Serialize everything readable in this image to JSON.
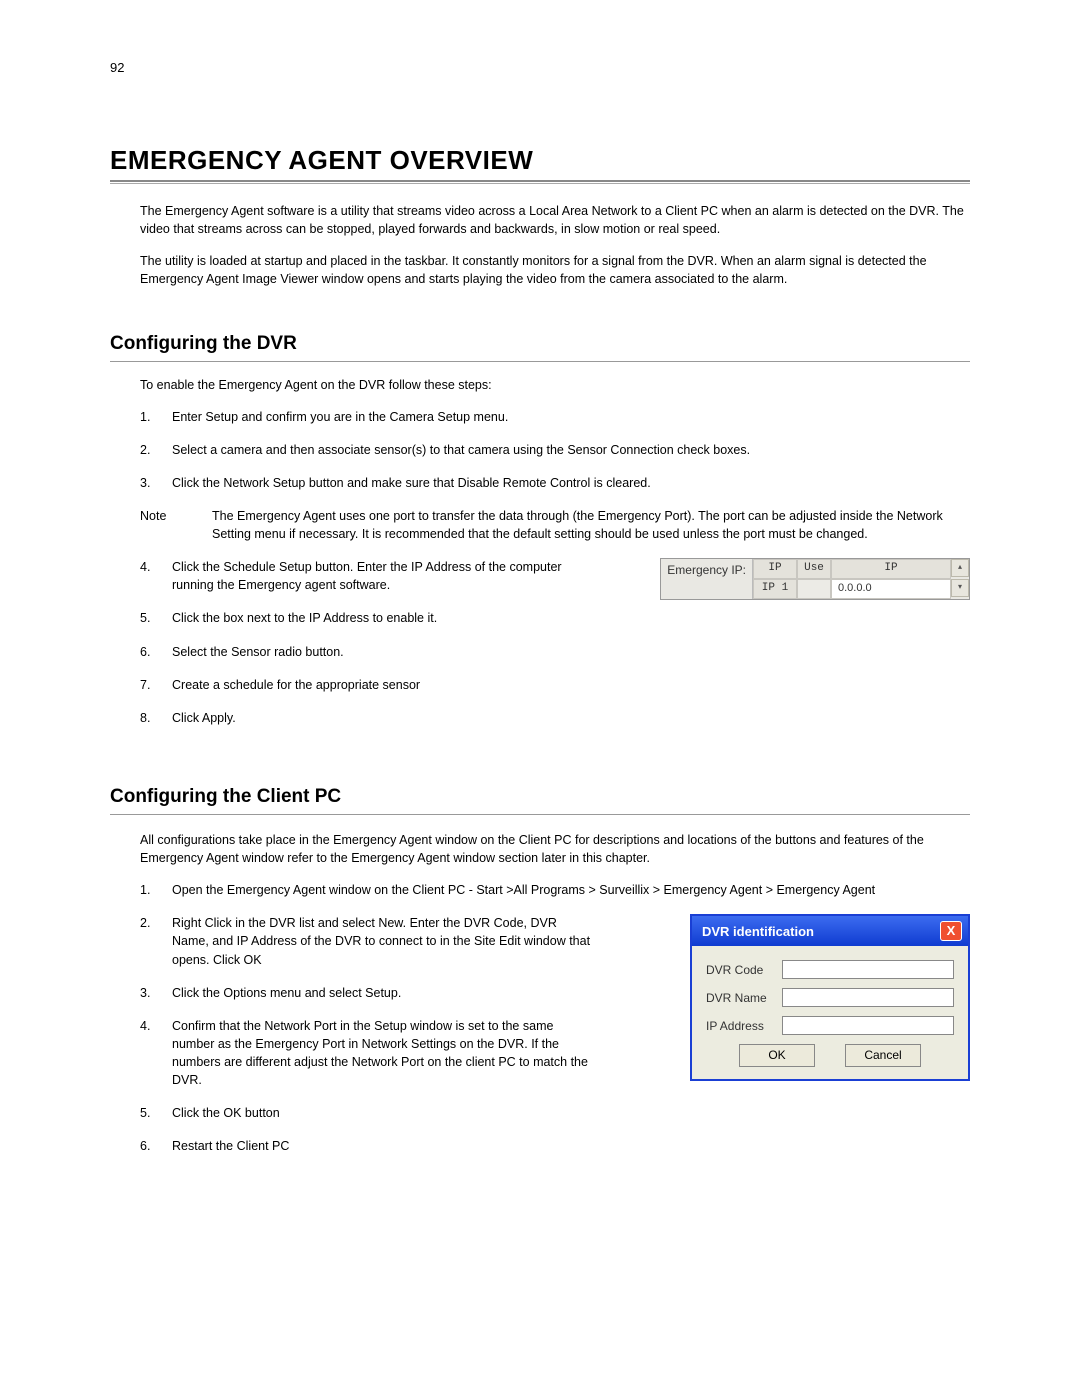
{
  "page_number": "92",
  "main_heading": "EMERGENCY AGENT OVERVIEW",
  "intro_p1": "The Emergency Agent software is a utility that streams video across a Local Area Network to a Client PC when an alarm is detected on the DVR. The video that streams across can be stopped, played forwards and backwards, in slow motion or real speed.",
  "intro_p2": "The utility is loaded at startup and placed in the taskbar. It constantly monitors for a signal from the DVR. When an alarm signal is detected the Emergency Agent Image Viewer window opens and starts playing the video from the camera associated to the alarm.",
  "section_dvr": {
    "title": "Configuring the DVR",
    "intro": "To enable the Emergency Agent on the DVR follow these steps:",
    "steps_before_note": [
      "Enter Setup and confirm you are in the Camera Setup menu.",
      "Select a camera and then associate sensor(s) to that camera using the Sensor Connection check boxes.",
      "Click the Network Setup button and make sure that Disable Remote Control is cleared."
    ],
    "note_label": "Note",
    "note_text": "The Emergency Agent uses one port to transfer the data through (the Emergency Port). The port can be adjusted inside the Network Setting menu if necessary. It is recommended that the default setting should be used unless the port must be changed.",
    "steps_after_note": [
      "Click the Schedule Setup button.  Enter the IP Address of the computer running the Emergency agent software.",
      "Click the box next to the IP Address to enable it.",
      "Select the Sensor radio button.",
      "Create a schedule for the appropriate sensor",
      "Click Apply."
    ]
  },
  "ip_panel": {
    "label": "Emergency IP:",
    "headers": {
      "col1": "IP",
      "col2": "Use",
      "col3": "IP"
    },
    "row": {
      "name": "IP 1",
      "value": "0.0.0.0"
    }
  },
  "section_client": {
    "title": "Configuring the Client PC",
    "intro": "All configurations take place in the Emergency Agent window on the Client PC for descriptions and locations of the buttons and features of the Emergency Agent window refer to the Emergency Agent window section later in this chapter.",
    "steps": [
      "Open the Emergency Agent window on the Client PC - Start >All Programs > Surveillix > Emergency Agent > Emergency Agent",
      "Right Click in the DVR list and select New.  Enter the DVR Code, DVR Name, and IP Address of the DVR to connect to in the Site Edit window that opens. Click OK",
      "Click the Options menu and select Setup.",
      "Confirm that the Network Port in the Setup window is set to the same number as the Emergency Port in Network Settings on the DVR. If the numbers are different adjust the Network Port on the client PC to match the DVR.",
      "Click the OK button",
      "Restart the Client PC"
    ]
  },
  "dvr_dialog": {
    "title": "DVR identification",
    "close": "X",
    "fields": [
      {
        "label": "DVR Code",
        "value": ""
      },
      {
        "label": "DVR Name",
        "value": ""
      },
      {
        "label": "IP Address",
        "value": ""
      }
    ],
    "ok": "OK",
    "cancel": "Cancel"
  }
}
